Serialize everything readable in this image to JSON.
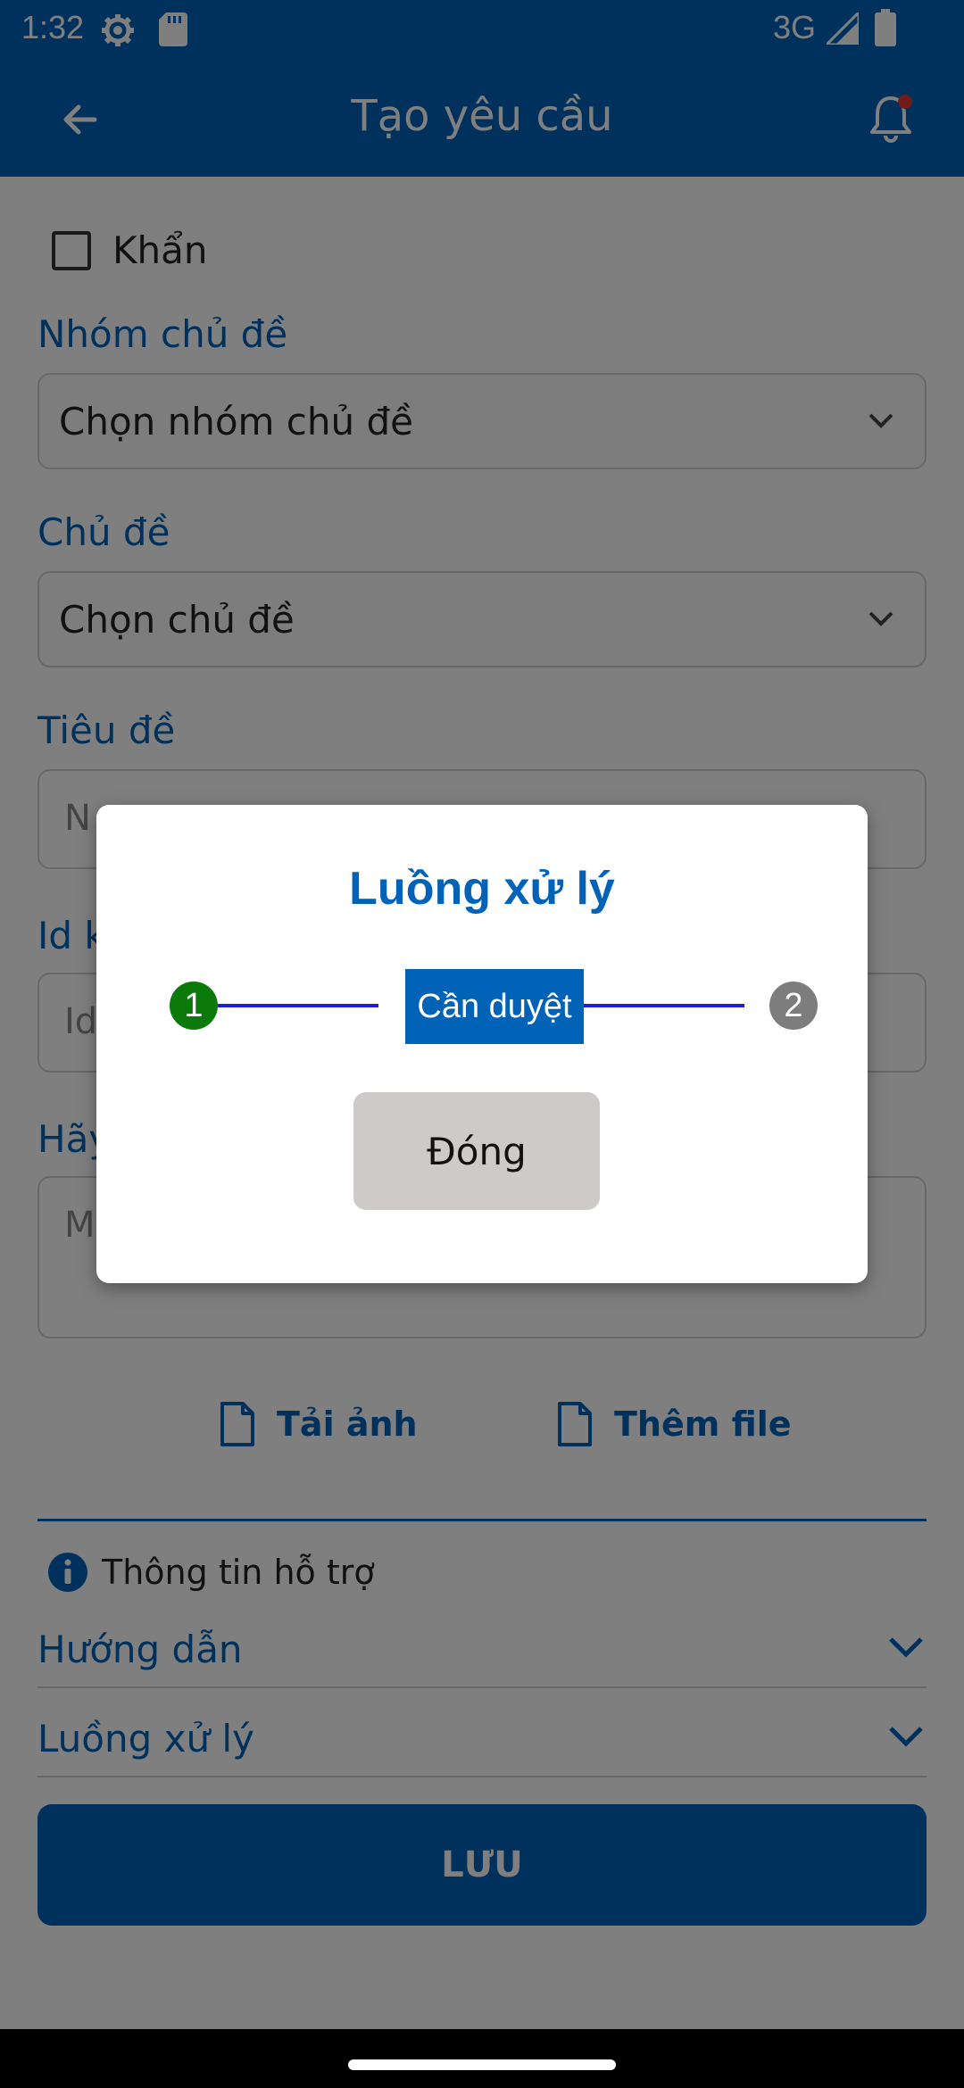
{
  "status_bar": {
    "time": "1:32",
    "network": "3G"
  },
  "app_bar": {
    "title": "Tạo yêu cầu"
  },
  "form": {
    "urgent_label": "Khẩn",
    "topic_group": {
      "label": "Nhóm chủ đề",
      "value": "Chọn nhóm chủ đề"
    },
    "topic": {
      "label": "Chủ đề",
      "value": "Chọn chủ đề"
    },
    "title_field": {
      "label": "Tiêu đề",
      "placeholder_visible": "N"
    },
    "id_field": {
      "label_visible": "Id k",
      "placeholder_visible": "Id"
    },
    "desc_field": {
      "label_visible": "Hãy",
      "placeholder_visible": "M"
    },
    "upload_image": "Tải ảnh",
    "add_file": "Thêm file",
    "support_info": "Thông tin hỗ trợ",
    "guide": "Hướng dẫn",
    "workflow": "Luồng xử lý",
    "save": "LƯU"
  },
  "dialog": {
    "title": "Luồng xử lý",
    "step1": "1",
    "step2": "2",
    "status": "Cần duyệt",
    "close": "Đóng"
  },
  "colors": {
    "primary": "#0063b8",
    "step_done": "#0b7a0b",
    "step_pending": "#7d7d7d"
  }
}
